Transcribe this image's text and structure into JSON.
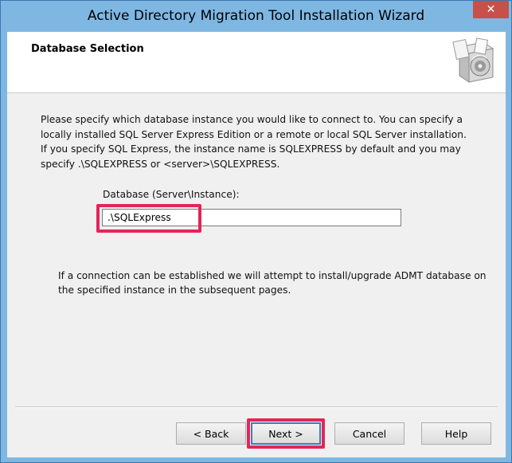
{
  "window": {
    "title": "Active Directory Migration Tool Installation Wizard",
    "close_glyph": "✕"
  },
  "header": {
    "section_title": "Database Selection",
    "icon": "installer-box-icon"
  },
  "description": {
    "line1": "Please specify which database instance you would like to connect to. You can specify a",
    "line2": "locally installed SQL Server Express Edition or a remote or local SQL Server installation.",
    "line3": "If you specify SQL Express, the instance name is SQLEXPRESS by default and you may",
    "line4": "specify .\\SQLEXPRESS or <server>\\SQLEXPRESS."
  },
  "database": {
    "label": "Database (Server\\Instance):",
    "value": ".\\SQLExpress"
  },
  "info": {
    "line1": "If a connection can be established we will attempt to install/upgrade ADMT database on",
    "line2": "the specified instance in the subsequent pages."
  },
  "buttons": {
    "back": "< Back",
    "next": "Next >",
    "cancel": "Cancel",
    "help": "Help"
  },
  "colors": {
    "titlebar": "#7fb7e3",
    "close_button": "#c7504b",
    "highlight": "#e3255a",
    "default_button_border": "#3c7fb1"
  }
}
